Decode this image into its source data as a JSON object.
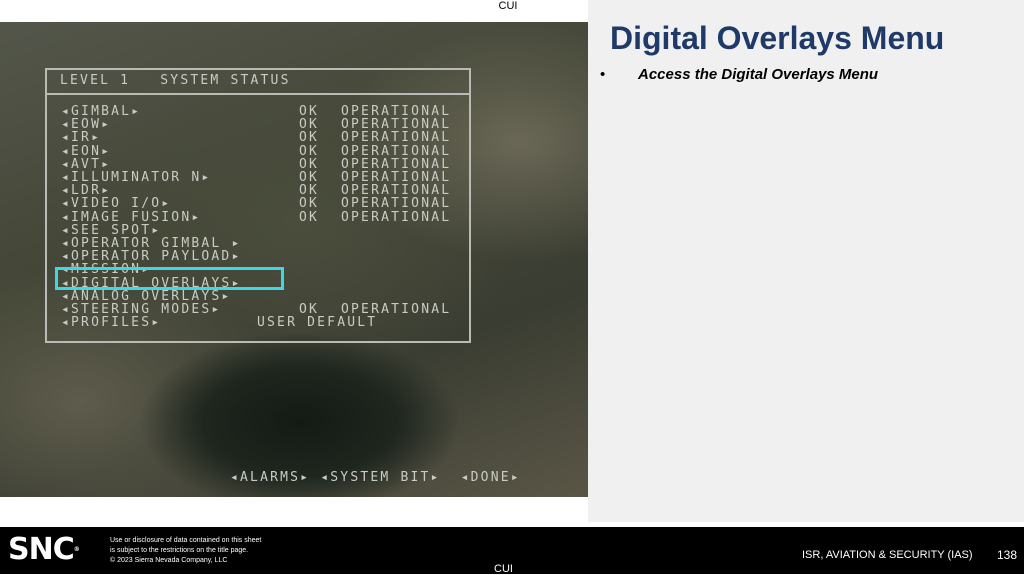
{
  "classification_top": "CUI",
  "classification_bottom": "CUI",
  "osd": {
    "title": "LEVEL 1   SYSTEM STATUS",
    "rows": [
      {
        "name": "◂GIMBAL▸",
        "ok": "OK",
        "status": "OPERATIONAL"
      },
      {
        "name": "◂EOW▸",
        "ok": "OK",
        "status": "OPERATIONAL"
      },
      {
        "name": "◂IR▸",
        "ok": "OK",
        "status": "OPERATIONAL"
      },
      {
        "name": "◂EON▸",
        "ok": "OK",
        "status": "OPERATIONAL"
      },
      {
        "name": "◂AVT▸",
        "ok": "OK",
        "status": "OPERATIONAL"
      },
      {
        "name": "◂ILLUMINATOR N▸",
        "ok": "OK",
        "status": "OPERATIONAL"
      },
      {
        "name": "◂LDR▸",
        "ok": "OK",
        "status": "OPERATIONAL"
      },
      {
        "name": "◂VIDEO I/O▸",
        "ok": "OK",
        "status": "OPERATIONAL"
      },
      {
        "name": "◂IMAGE FUSION▸",
        "ok": "OK",
        "status": "OPERATIONAL"
      },
      {
        "name": "◂SEE SPOT▸"
      },
      {
        "name": "◂OPERATOR GIMBAL ▸"
      },
      {
        "name": "◂OPERATOR PAYLOAD▸"
      },
      {
        "name": "◂MISSION▸"
      },
      {
        "name": "◂DIGITAL OVERLAYS▸"
      },
      {
        "name": "◂ANALOG OVERLAYS▸"
      },
      {
        "name": "◂STEERING MODES▸",
        "ok": "OK",
        "status": "OPERATIONAL"
      },
      {
        "name": "◂PROFILES▸",
        "user": "USER DEFAULT"
      }
    ],
    "bottom": "◂ALARMS▸ ◂SYSTEM BIT▸  ◂DONE▸",
    "highlight_color": "#3fd6e6"
  },
  "slide": {
    "title": "Digital Overlays Menu",
    "bullet": "•",
    "bullet_text": "Access the Digital Overlays Menu"
  },
  "footer": {
    "logo": "SNC",
    "disclaimer": [
      "Use or disclosure of data contained on this sheet",
      "is subject to the restrictions on the title page.",
      "© 2023 Sierra Nevada Company, LLC"
    ],
    "division": "ISR, AVIATION & SECURITY (IAS)",
    "page": "138"
  }
}
